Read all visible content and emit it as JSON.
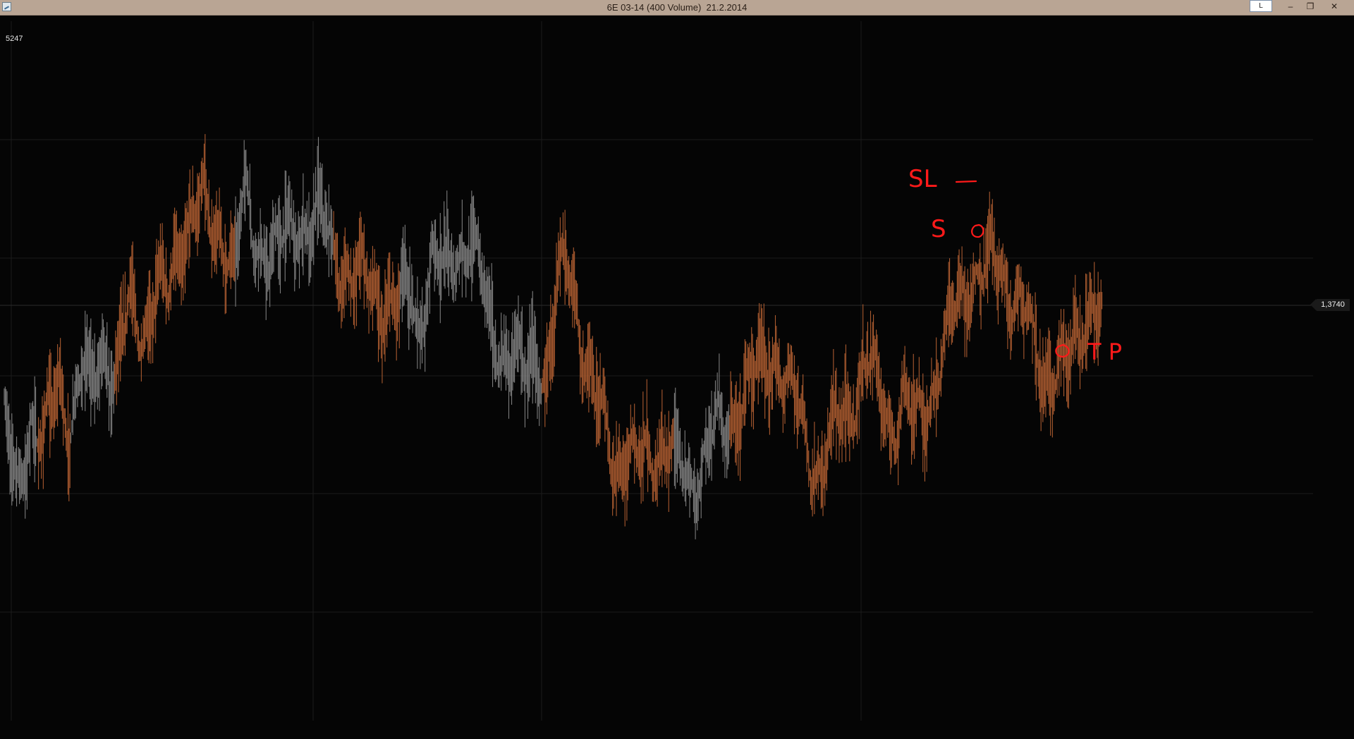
{
  "window": {
    "title": "6E 03-14 (400 Volume)  21.2.2014",
    "login_label": "L",
    "minimize_glyph": "–",
    "restore_glyph": "❐",
    "close_glyph": "✕"
  },
  "chart_data": {
    "type": "bar",
    "style": "tick-bars",
    "instrument": "6E 03-14",
    "bar_type": "400 Volume",
    "volume_readout": "5247",
    "last_price": "1,3740",
    "grid": true,
    "colors": {
      "background": "#050505",
      "up_bars": "#a95a2f",
      "down_bars": "#7d7d7d",
      "grid": "#1c1c1c",
      "annotation": "#ff1a1a"
    },
    "price_path": [
      [
        0.0,
        1.3718
      ],
      [
        0.01,
        1.3702
      ],
      [
        0.02,
        1.3722
      ],
      [
        0.03,
        1.3713
      ],
      [
        0.042,
        1.3728
      ],
      [
        0.05,
        1.372
      ],
      [
        0.06,
        1.3732
      ],
      [
        0.066,
        1.3724
      ],
      [
        0.075,
        1.3738
      ],
      [
        0.085,
        1.3731
      ],
      [
        0.095,
        1.3744
      ],
      [
        0.105,
        1.374
      ],
      [
        0.115,
        1.3752
      ],
      [
        0.125,
        1.3746
      ],
      [
        0.135,
        1.3762
      ],
      [
        0.143,
        1.377
      ],
      [
        0.15,
        1.3769
      ],
      [
        0.16,
        1.376
      ],
      [
        0.166,
        1.3765
      ],
      [
        0.175,
        1.3757
      ],
      [
        0.183,
        1.377
      ],
      [
        0.19,
        1.376
      ],
      [
        0.2,
        1.3761
      ],
      [
        0.21,
        1.3759
      ],
      [
        0.22,
        1.3763
      ],
      [
        0.23,
        1.3767
      ],
      [
        0.24,
        1.3766
      ],
      [
        0.25,
        1.3758
      ],
      [
        0.26,
        1.3756
      ],
      [
        0.27,
        1.3752
      ],
      [
        0.28,
        1.375
      ],
      [
        0.29,
        1.3748
      ],
      [
        0.3,
        1.3745
      ],
      [
        0.31,
        1.3749
      ],
      [
        0.316,
        1.3742
      ],
      [
        0.325,
        1.3757
      ],
      [
        0.335,
        1.3752
      ],
      [
        0.345,
        1.376
      ],
      [
        0.353,
        1.3762
      ],
      [
        0.36,
        1.3755
      ],
      [
        0.37,
        1.3743
      ],
      [
        0.38,
        1.3736
      ],
      [
        0.39,
        1.3732
      ],
      [
        0.396,
        1.3729
      ],
      [
        0.405,
        1.3738
      ],
      [
        0.413,
        1.373
      ],
      [
        0.42,
        1.3745
      ],
      [
        0.428,
        1.3757
      ],
      [
        0.435,
        1.375
      ],
      [
        0.442,
        1.3735
      ],
      [
        0.45,
        1.3722
      ],
      [
        0.458,
        1.3718
      ],
      [
        0.465,
        1.371
      ],
      [
        0.472,
        1.3713
      ],
      [
        0.48,
        1.3708
      ],
      [
        0.49,
        1.3712
      ],
      [
        0.5,
        1.3715
      ],
      [
        0.51,
        1.371
      ],
      [
        0.52,
        1.3706
      ],
      [
        0.53,
        1.371
      ],
      [
        0.54,
        1.3715
      ],
      [
        0.55,
        1.3718
      ],
      [
        0.56,
        1.3725
      ],
      [
        0.57,
        1.3728
      ],
      [
        0.58,
        1.3733
      ],
      [
        0.587,
        1.3737
      ],
      [
        0.595,
        1.3727
      ],
      [
        0.605,
        1.3721
      ],
      [
        0.615,
        1.3712
      ],
      [
        0.623,
        1.3707
      ],
      [
        0.63,
        1.3715
      ],
      [
        0.64,
        1.3722
      ],
      [
        0.65,
        1.3728
      ],
      [
        0.657,
        1.3732
      ],
      [
        0.663,
        1.3728
      ],
      [
        0.67,
        1.3723
      ],
      [
        0.678,
        1.372
      ],
      [
        0.685,
        1.3724
      ],
      [
        0.692,
        1.3718
      ],
      [
        0.7,
        1.3722
      ],
      [
        0.708,
        1.3729
      ],
      [
        0.715,
        1.3735
      ],
      [
        0.722,
        1.3742
      ],
      [
        0.73,
        1.375
      ],
      [
        0.736,
        1.3753
      ],
      [
        0.742,
        1.3754
      ],
      [
        0.748,
        1.3753
      ],
      [
        0.752,
        1.3756
      ],
      [
        0.758,
        1.3755
      ],
      [
        0.765,
        1.3751
      ],
      [
        0.772,
        1.3749
      ],
      [
        0.778,
        1.3743
      ],
      [
        0.785,
        1.3734
      ],
      [
        0.792,
        1.3731
      ],
      [
        0.8,
        1.3733
      ],
      [
        0.806,
        1.3731
      ],
      [
        0.812,
        1.3732
      ],
      [
        0.818,
        1.3738
      ],
      [
        0.824,
        1.3746
      ],
      [
        0.83,
        1.3749
      ],
      [
        0.836,
        1.3742
      ]
    ],
    "bar_pattern": [
      0,
      0,
      0,
      1,
      1,
      1,
      0,
      0,
      0,
      0,
      1,
      1,
      1,
      1,
      1,
      1,
      1,
      1,
      1,
      1,
      1,
      0,
      0,
      0,
      0,
      0,
      0,
      0,
      0,
      0,
      1,
      1,
      1,
      1,
      1,
      1,
      0,
      0,
      0,
      0,
      0,
      0,
      0,
      0,
      0,
      0,
      0,
      0,
      0,
      1,
      1,
      1,
      1,
      1,
      1,
      1,
      1,
      1,
      1,
      1,
      1,
      0,
      0,
      0,
      0,
      0,
      1,
      1,
      1,
      1,
      1,
      1,
      1,
      1,
      1,
      1,
      1,
      1,
      1,
      1,
      1,
      1,
      1,
      1,
      1,
      1,
      1,
      1,
      1,
      1,
      1,
      1,
      1,
      1,
      1,
      1,
      1,
      1,
      1,
      1
    ],
    "annotations": [
      "SL",
      "S",
      "TP"
    ]
  }
}
